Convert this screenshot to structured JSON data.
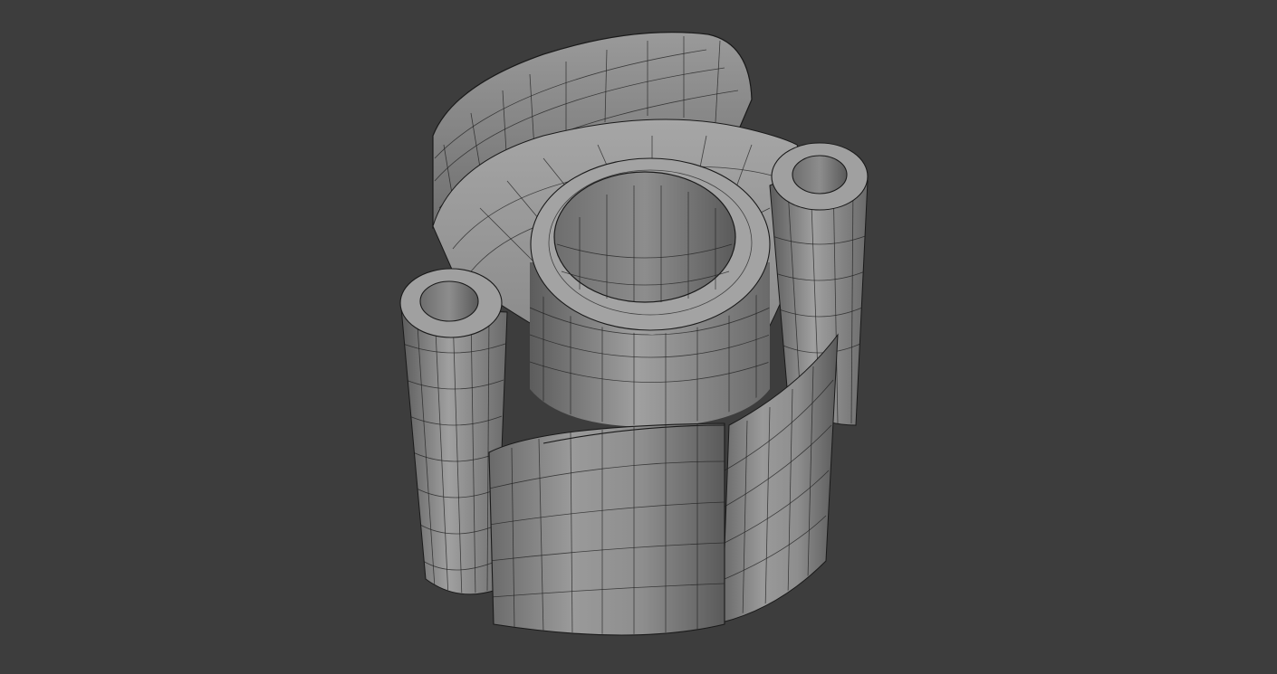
{
  "viewport": {
    "background": "#3d3d3d",
    "object": {
      "kind": "subdivided mesh part (wireframe overlay)",
      "surface_color": "#8a8a8a",
      "wire_color": "#1f1f1f"
    }
  }
}
